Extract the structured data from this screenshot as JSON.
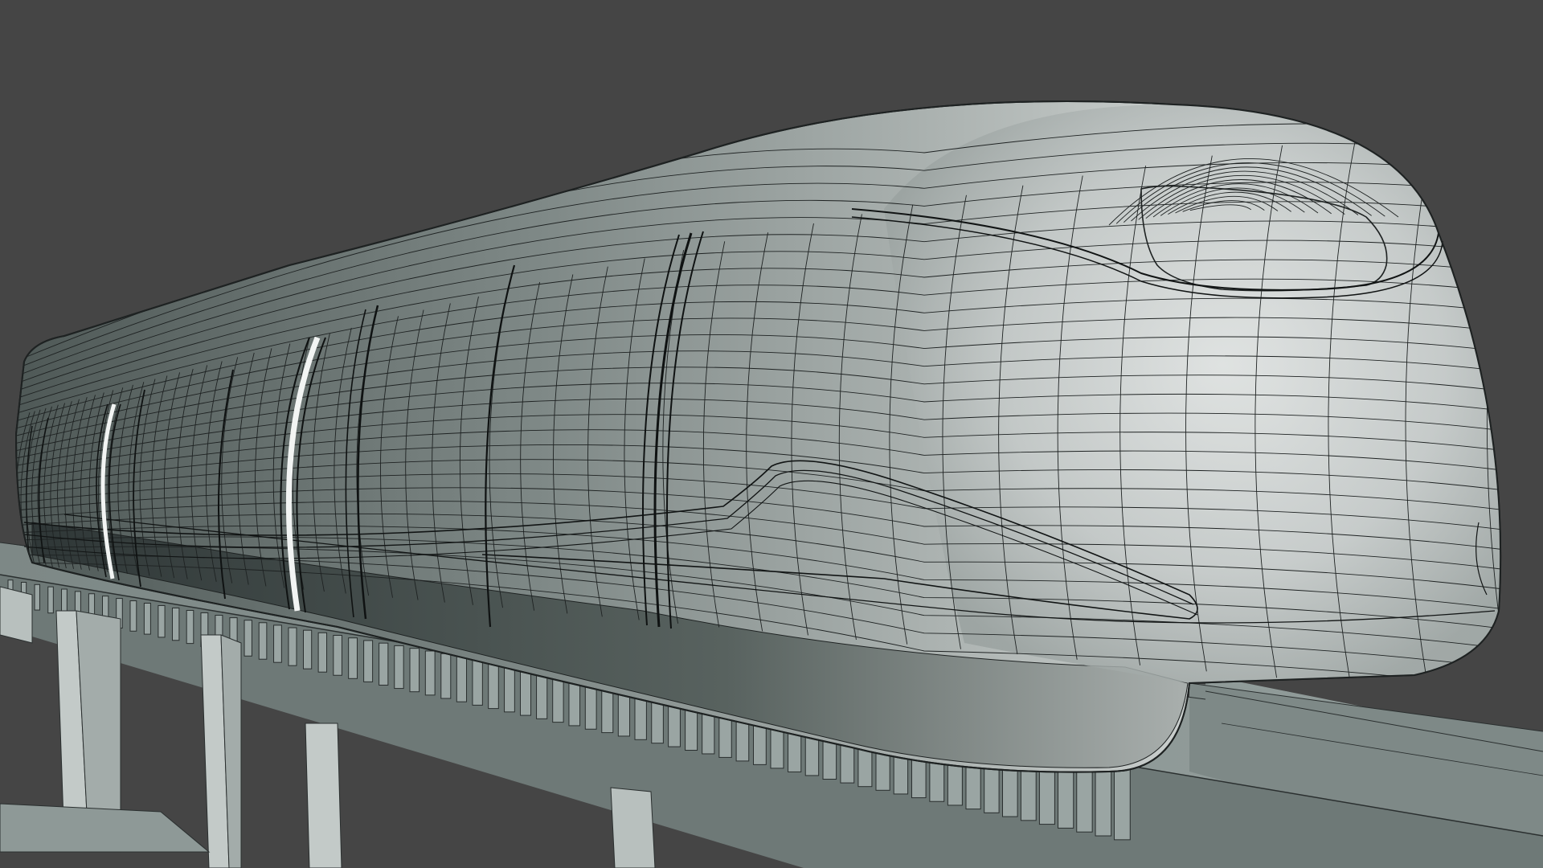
{
  "viewport": {
    "background_color": "#454545",
    "display_mode": "shaded-wireframe"
  },
  "scene": {
    "objects": [
      {
        "name": "monorail-train",
        "body_color": "#a8b0ae",
        "wire_color": "#1e2222"
      },
      {
        "name": "elevated-guideway",
        "body_color": "#8a9593",
        "wire_color": "#2a2f2f"
      }
    ]
  }
}
